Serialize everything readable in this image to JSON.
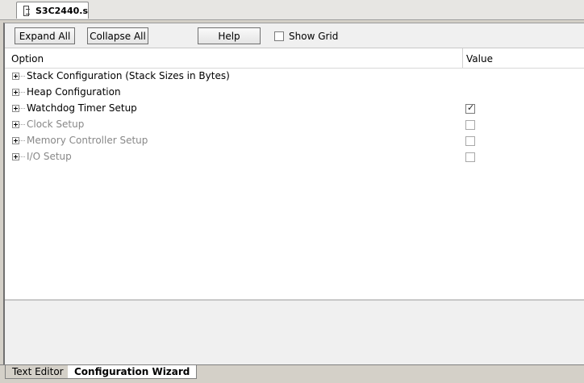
{
  "file_tab": {
    "label": "S3C2440.s",
    "icon": "document-icon"
  },
  "toolbar": {
    "expand_all": "Expand All",
    "collapse_all": "Collapse All",
    "help": "Help",
    "show_grid": "Show Grid",
    "show_grid_checked": false
  },
  "table": {
    "option_header": "Option",
    "value_header": "Value"
  },
  "rows": [
    {
      "label": "Stack Configuration (Stack Sizes in Bytes)",
      "enabled": true,
      "has_value": false
    },
    {
      "label": "Heap Configuration",
      "enabled": true,
      "has_value": false
    },
    {
      "label": "Watchdog Timer Setup",
      "enabled": true,
      "has_value": true,
      "checked": true
    },
    {
      "label": "Clock Setup",
      "enabled": false,
      "has_value": true,
      "checked": false
    },
    {
      "label": "Memory Controller Setup",
      "enabled": false,
      "has_value": true,
      "checked": false
    },
    {
      "label": "I/O Setup",
      "enabled": false,
      "has_value": true,
      "checked": false
    }
  ],
  "bottom_tabs": [
    {
      "label": "Text Editor",
      "active": false
    },
    {
      "label": "Configuration Wizard",
      "active": true
    }
  ]
}
